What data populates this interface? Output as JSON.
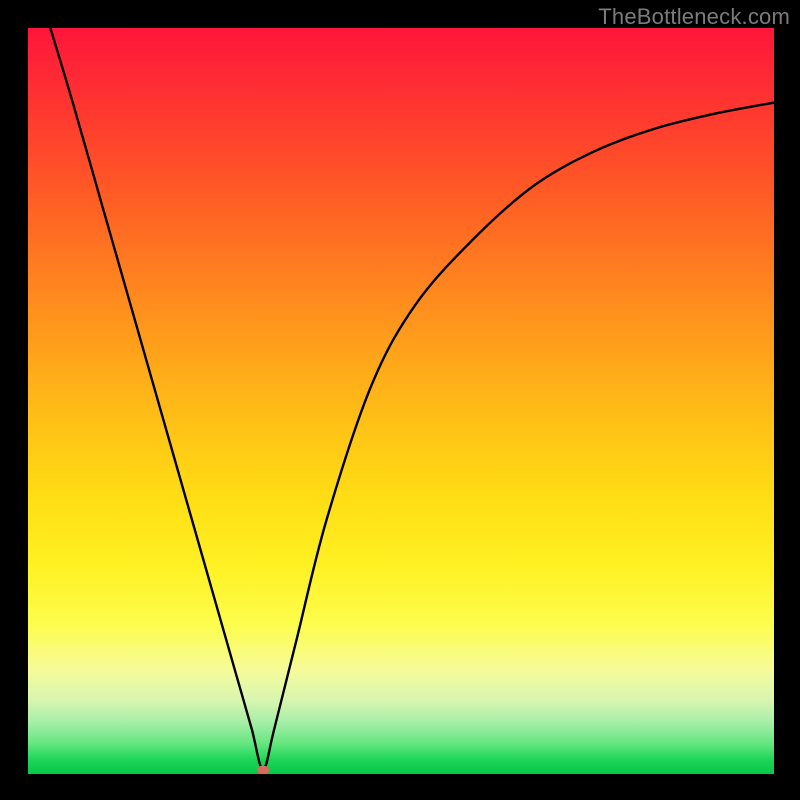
{
  "watermark": "TheBottleneck.com",
  "colors": {
    "frame": "#000000",
    "curve_stroke": "#000000",
    "marker_fill": "#d86a5e",
    "watermark_text": "#7b7b7b"
  },
  "chart_data": {
    "type": "line",
    "title": "",
    "xlabel": "",
    "ylabel": "",
    "xlim": [
      0,
      100
    ],
    "ylim": [
      0,
      100
    ],
    "grid": false,
    "legend": false,
    "annotations": [
      "TheBottleneck.com"
    ],
    "marker": {
      "x": 31.5,
      "y": 0.6
    },
    "series": [
      {
        "name": "bottleneck-curve",
        "x": [
          3,
          6,
          10,
          14,
          18,
          22,
          26,
          28,
          30,
          31.5,
          33,
          36,
          40,
          46,
          52,
          60,
          68,
          76,
          84,
          92,
          100
        ],
        "y": [
          100,
          90,
          76,
          62,
          48,
          34,
          20,
          13,
          6,
          0.6,
          6,
          18,
          34,
          52,
          63,
          72,
          79,
          83.5,
          86.5,
          88.5,
          90
        ]
      }
    ],
    "gradient_stops": [
      {
        "pos": 0,
        "color": "#ff153b"
      },
      {
        "pos": 8,
        "color": "#ff2e33"
      },
      {
        "pos": 22,
        "color": "#ff5a25"
      },
      {
        "pos": 36,
        "color": "#ff8a1e"
      },
      {
        "pos": 50,
        "color": "#ffb817"
      },
      {
        "pos": 62,
        "color": "#ffdb14"
      },
      {
        "pos": 72,
        "color": "#fff123"
      },
      {
        "pos": 80,
        "color": "#fdfd4d"
      },
      {
        "pos": 86,
        "color": "#f6fb99"
      },
      {
        "pos": 90,
        "color": "#d9f6b0"
      },
      {
        "pos": 93,
        "color": "#a7efa8"
      },
      {
        "pos": 96,
        "color": "#62e67e"
      },
      {
        "pos": 98,
        "color": "#1fd65a"
      },
      {
        "pos": 100,
        "color": "#07c646"
      }
    ]
  }
}
